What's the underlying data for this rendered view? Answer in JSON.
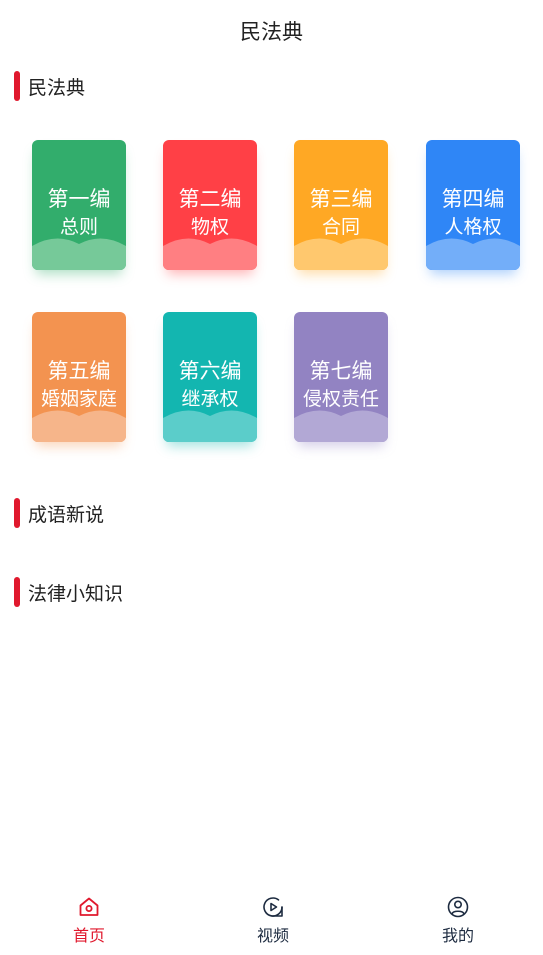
{
  "header": {
    "title": "民法典"
  },
  "sections": {
    "civil_code": "民法典",
    "idioms": "成语新说",
    "legal_tips": "法律小知识"
  },
  "books": [
    {
      "part": "第一编",
      "name": "总则",
      "color": "#32ad6c",
      "light": "#76c999"
    },
    {
      "part": "第二编",
      "name": "物权",
      "color": "#ff4046",
      "light": "#ff7f82"
    },
    {
      "part": "第三编",
      "name": "合同",
      "color": "#ffa824",
      "light": "#ffc86e"
    },
    {
      "part": "第四编",
      "name": "人格权",
      "color": "#2f86f6",
      "light": "#73aef9"
    },
    {
      "part": "第五编",
      "name": "婚姻家庭",
      "color": "#f39350",
      "light": "#f6b58a"
    },
    {
      "part": "第六编",
      "name": "继承权",
      "color": "#13b6b0",
      "light": "#5bcdca"
    },
    {
      "part": "第七编",
      "name": "侵权责任",
      "color": "#9283c2",
      "light": "#b2a8d5"
    }
  ],
  "tabs": [
    {
      "label": "首页",
      "active": true
    },
    {
      "label": "视频",
      "active": false
    },
    {
      "label": "我的",
      "active": false
    }
  ],
  "colors": {
    "accent": "#e0182d",
    "tab_inactive": "#1d2b40"
  }
}
